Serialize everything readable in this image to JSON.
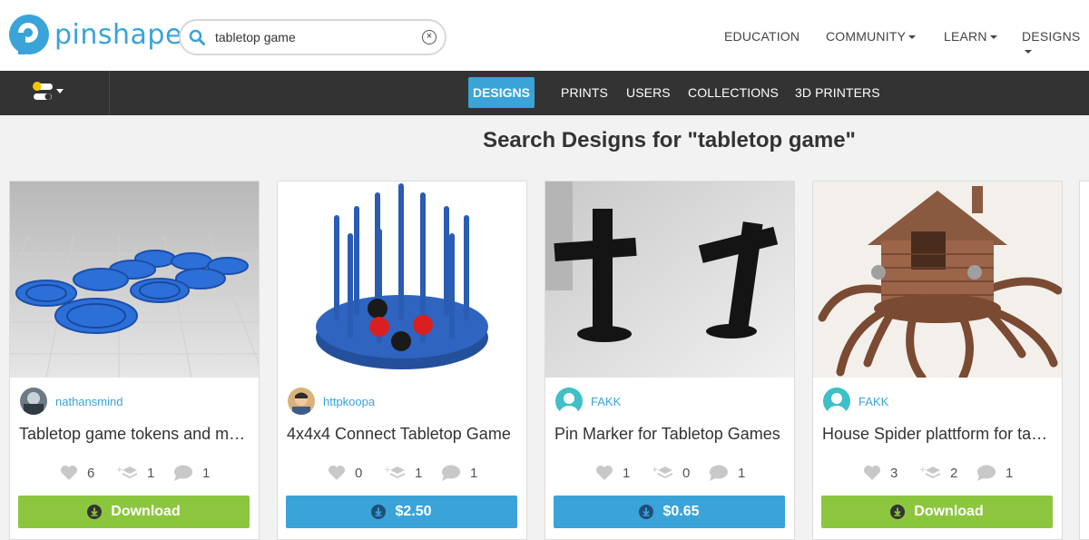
{
  "header": {
    "logo_text": "pinshape",
    "search": {
      "value": "tabletop game",
      "clear_icon": "close-circle-icon"
    },
    "nav": [
      {
        "label": "EDUCATION",
        "dropdown": false
      },
      {
        "label": "COMMUNITY",
        "dropdown": true
      },
      {
        "label": "LEARN",
        "dropdown": true
      },
      {
        "label": "DESIGNS",
        "dropdown": true
      }
    ]
  },
  "subnav": {
    "tabs": [
      "DESIGNS",
      "PRINTS",
      "USERS",
      "COLLECTIONS",
      "3D PRINTERS"
    ],
    "active": "DESIGNS"
  },
  "page_title": "Search Designs for \"tabletop game\"",
  "cards": [
    {
      "author": "nathansmind",
      "title": "Tabletop game tokens and mar…",
      "likes": "6",
      "makes": "1",
      "comments": "1",
      "button": "Download",
      "button_type": "download"
    },
    {
      "author": "httpkoopa",
      "title": "4x4x4 Connect Tabletop Game",
      "likes": "0",
      "makes": "1",
      "comments": "1",
      "button": "$2.50",
      "button_type": "price"
    },
    {
      "author": "FAKK",
      "title": "Pin Marker for Tabletop Games",
      "likes": "1",
      "makes": "0",
      "comments": "1",
      "button": "$0.65",
      "button_type": "price"
    },
    {
      "author": "FAKK",
      "title": "House Spider plattform for ta…",
      "likes": "3",
      "makes": "2",
      "comments": "1",
      "button": "Download",
      "button_type": "download"
    }
  ],
  "colors": {
    "brand": "#3aa3d8",
    "download": "#8cc63f",
    "darkbar": "#333333"
  }
}
